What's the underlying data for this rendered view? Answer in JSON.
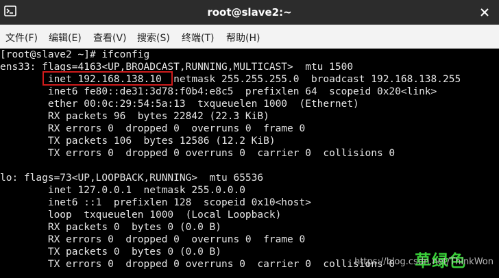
{
  "window": {
    "title": "root@slave2:~"
  },
  "menu": [
    {
      "label": "文件(F)"
    },
    {
      "label": "编辑(E)"
    },
    {
      "label": "查看(V)"
    },
    {
      "label": "搜索(S)"
    },
    {
      "label": "终端(T)"
    },
    {
      "label": "帮助(H)"
    }
  ],
  "terminal": {
    "lines": [
      "[root@slave2 ~]# ifconfig",
      "ens33: flags=4163<UP,BROADCAST,RUNNING,MULTICAST>  mtu 1500",
      "        inet 192.168.138.10  netmask 255.255.255.0  broadcast 192.168.138.255",
      "        inet6 fe80::de31:3d78:f0b4:e8c5  prefixlen 64  scopeid 0x20<link>",
      "        ether 00:0c:29:54:5a:13  txqueuelen 1000  (Ethernet)",
      "        RX packets 96  bytes 22842 (22.3 KiB)",
      "        RX errors 0  dropped 0  overruns 0  frame 0",
      "        TX packets 106  bytes 12586 (12.2 KiB)",
      "        TX errors 0  dropped 0 overruns 0  carrier 0  collisions 0",
      "",
      "lo: flags=73<UP,LOOPBACK,RUNNING>  mtu 65536",
      "        inet 127.0.0.1  netmask 255.0.0.0",
      "        inet6 ::1  prefixlen 128  scopeid 0x10<host>",
      "        loop  txqueuelen 1000  (Local Loopback)",
      "        RX packets 0  bytes 0 (0.0 B)",
      "        RX errors 0  dropped 0  overruns 0  frame 0",
      "        TX packets 0  bytes 0 (0.0 B)",
      "        TX errors 0  dropped 0 overruns 0  carrier 0  collisions 0"
    ]
  },
  "overlay": {
    "watermark": "草绿色",
    "credit": "https://blog.csdn.net/ThinkWon"
  },
  "colors": {
    "titlebar": "#2c2c2c",
    "menubar": "#f3f3f3",
    "terminal_bg": "#000000",
    "terminal_fg": "#e6e6e6",
    "highlight": "#d11b1b",
    "watermark": "#39d039"
  },
  "icons": {
    "app": "terminal-icon",
    "close": "close-icon"
  }
}
